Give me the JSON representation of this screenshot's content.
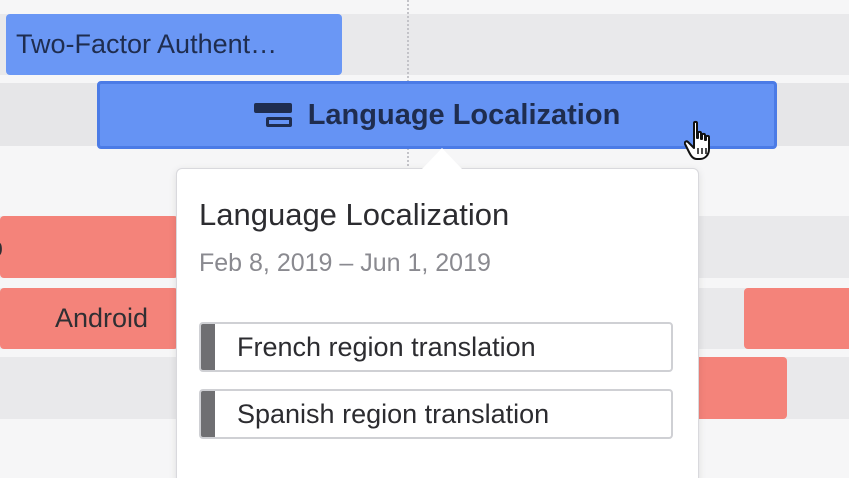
{
  "timeline": {
    "bars": {
      "two_factor": "Two-Factor Authent…",
      "language_localization": "Language Localization",
      "red_row_1": "p",
      "red_row_2": "Android"
    }
  },
  "tooltip": {
    "title": "Language Localization",
    "dates": "Feb 8, 2019 – Jun 1, 2019",
    "subtasks": [
      {
        "label": "French region translation"
      },
      {
        "label": "Spanish region translation"
      }
    ]
  },
  "colors": {
    "selected_bar": "#6593f4",
    "bar_blue": "#6a97f5",
    "bar_red": "#f4837a",
    "subtask_stripe": "#6f6f72"
  },
  "icons": {
    "bar_icon": "subtasks-icon",
    "cursor": "hand-pointer-cursor-icon"
  }
}
